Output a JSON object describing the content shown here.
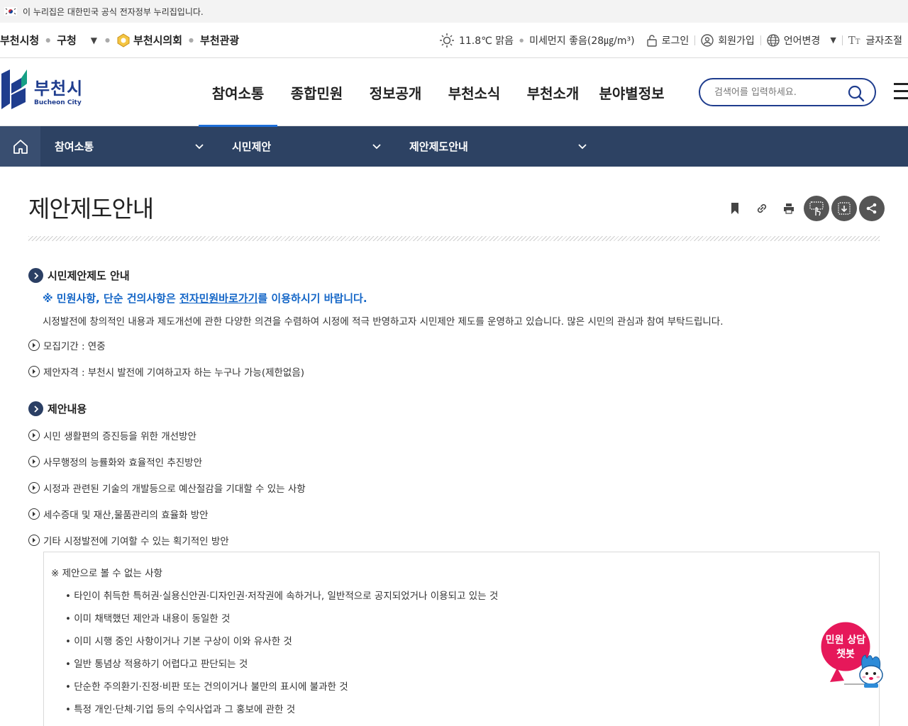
{
  "gov_banner": {
    "text": "이 누리집은 대한민국 공식 전자정부 누리집입니다."
  },
  "util": {
    "left_links": [
      "부천시청",
      "구청",
      "부천시의회",
      "부천관광"
    ],
    "weather": "11.8℃ 맑음",
    "dust": "미세먼지 좋음(28㎍/m³)",
    "login": "로그인",
    "signup": "회원가입",
    "language": "언어변경",
    "font_size": "글자조절"
  },
  "logo": {
    "ko": "부천시",
    "en": "Bucheon City"
  },
  "gnb": [
    "참여소통",
    "종합민원",
    "정보공개",
    "부천소식",
    "부천소개",
    "분야별정보"
  ],
  "search": {
    "placeholder": "검색어를 입력하세요."
  },
  "subnav": [
    "참여소통",
    "시민제안",
    "제안제도안내"
  ],
  "page": {
    "title": "제안제도안내",
    "section1": {
      "title": "시민제안제도 안내",
      "notice_prefix": "※ 민원사항, 단순 건의사항은 ",
      "notice_link": "전자민원바로가기",
      "notice_suffix": "를 이용하시기 바랍니다.",
      "description": "시정발전에 창의적인 내용과 제도개선에 관한 다양한 의견을 수렴하여 시정에 적극 반영하고자 시민제안 제도를 운영하고 있습니다. 많은 시민의 관심과 참여 부탁드립니다.",
      "items": [
        "모집기간 : 연중",
        "제안자격 : 부천시 발전에 기여하고자 하는 누구나 가능(제한없음)"
      ]
    },
    "section2": {
      "title": "제안내용",
      "items": [
        "시민 생활편의 증진등을 위한 개선방안",
        "사무행정의 능률화와 효율적인 추진방안",
        "시정과 관련된 기술의 개발등으로 예산절감을 기대할 수 있는 사항",
        "세수증대 및 재산,물품관리의 효율화 방안",
        "기타 시정발전에 기여할 수 있는 획기적인 방안"
      ]
    },
    "box": {
      "head": "※ 제안으로 볼 수 없는 사항",
      "items": [
        "타인이 취득한 특허권·실용신안권·디자인권·저작권에 속하거나, 일반적으로 공지되었거나 이용되고 있는 것",
        "이미 채택했던 제안과 내용이 동일한 것",
        "이미 시행 중인 사항이거나 기본 구상이 이와 유사한 것",
        "일반 통념상 적용하기 어렵다고 판단되는 것",
        "단순한 주의환기·진정·비판 또는 건의이거나 불만의 표시에 불과한 것",
        "특정 개인·단체·기업 등의 수익사업과 그 홍보에 관한 것"
      ]
    }
  },
  "chatbot": {
    "line1": "민원 상담",
    "line2": "챗봇"
  },
  "colors": {
    "navy": "#2d4263",
    "accent_blue": "#1466c7",
    "logo_blue": "#1f3d8e",
    "chatbot_pink": "#e6185a"
  }
}
